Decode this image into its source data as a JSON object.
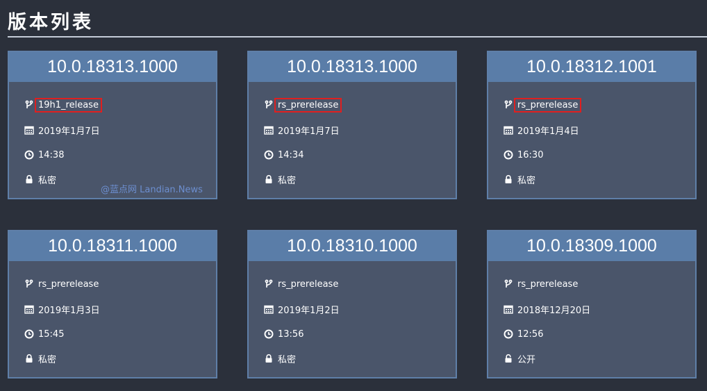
{
  "page": {
    "title": "版本列表"
  },
  "watermark": "@蓝点网 Landian.News",
  "builds": [
    {
      "version": "10.0.18313.1000",
      "branch": "19h1_release",
      "date": "2019年1月7日",
      "time": "14:38",
      "visibility": "私密",
      "lock": "locked",
      "highlighted": true
    },
    {
      "version": "10.0.18313.1000",
      "branch": "rs_prerelease",
      "date": "2019年1月7日",
      "time": "14:34",
      "visibility": "私密",
      "lock": "locked",
      "highlighted": true
    },
    {
      "version": "10.0.18312.1001",
      "branch": "rs_prerelease",
      "date": "2019年1月4日",
      "time": "16:30",
      "visibility": "私密",
      "lock": "locked",
      "highlighted": true
    },
    {
      "version": "10.0.18311.1000",
      "branch": "rs_prerelease",
      "date": "2019年1月3日",
      "time": "15:45",
      "visibility": "私密",
      "lock": "locked",
      "highlighted": false
    },
    {
      "version": "10.0.18310.1000",
      "branch": "rs_prerelease",
      "date": "2019年1月2日",
      "time": "13:56",
      "visibility": "私密",
      "lock": "locked",
      "highlighted": false
    },
    {
      "version": "10.0.18309.1000",
      "branch": "rs_prerelease",
      "date": "2018年12月20日",
      "time": "12:56",
      "visibility": "公开",
      "lock": "unlocked",
      "highlighted": false
    }
  ],
  "colors": {
    "background": "#2b303b",
    "card": "#4a556a",
    "card_header": "#5a7da8",
    "highlight_border": "#e01f1f",
    "watermark": "#6c8ecf"
  }
}
